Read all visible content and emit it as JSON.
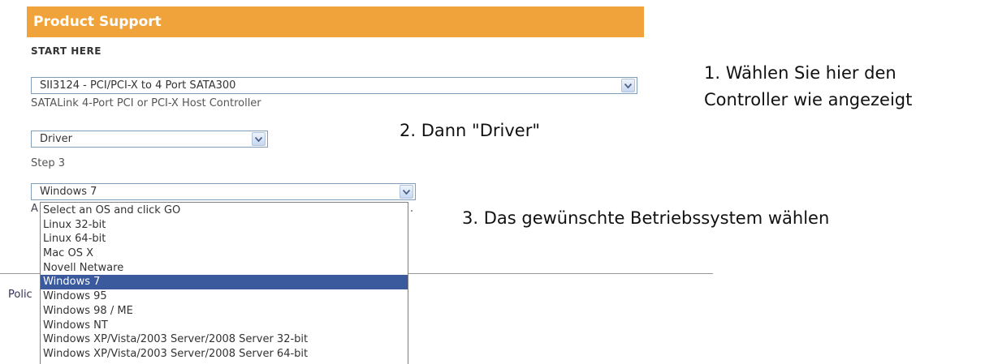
{
  "header": {
    "title": "Product Support"
  },
  "start_here": "START HERE",
  "step1": {
    "selected": "SII3124 - PCI/PCI-X to 4 Port SATA300",
    "description": "SATALink 4-Port PCI or PCI-X Host Controller"
  },
  "step2": {
    "selected": "Driver"
  },
  "step3": {
    "label": "Step 3",
    "selected": "Windows 7",
    "options": [
      "Select an OS and click GO",
      "Linux 32-bit",
      "Linux 64-bit",
      "Mac OS X",
      "Novell Netware",
      "Windows 7",
      "Windows 95",
      "Windows 98 / ME",
      "Windows NT",
      "Windows XP/Vista/2003 Server/2008 Server 32-bit",
      "Windows XP/Vista/2003 Server/2008 Server 64-bit"
    ],
    "highlighted_index": 5
  },
  "fragments": {
    "left_a": "A",
    "right_dot": ".",
    "footer_left": "Polic"
  },
  "annotations": {
    "line1": "1. Wählen Sie hier den",
    "line2": "Controller wie angezeigt",
    "step2": "2. Dann \"Driver\"",
    "step3": "3. Das gewünschte Betriebssystem wählen"
  },
  "colors": {
    "header_bg": "#f0a33b",
    "selection_bg": "#3a5a9d"
  },
  "icons": {
    "dropdown": "chevron-down-icon"
  }
}
